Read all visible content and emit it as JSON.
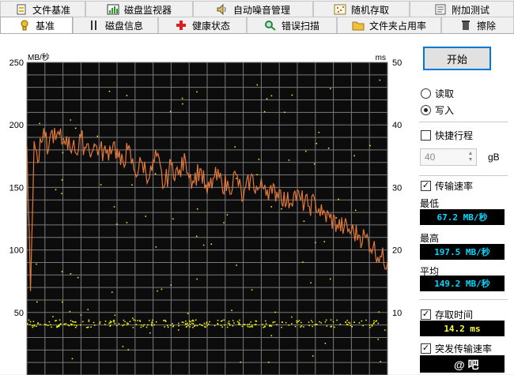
{
  "tabs_top": [
    {
      "label": "文件基准",
      "icon": "file-benchmark-icon"
    },
    {
      "label": "磁盘监视器",
      "icon": "disk-monitor-icon"
    },
    {
      "label": "自动噪音管理",
      "icon": "speaker-icon"
    },
    {
      "label": "随机存取",
      "icon": "random-access-icon"
    },
    {
      "label": "附加测试",
      "icon": "extra-tests-icon"
    }
  ],
  "tabs_bottom": [
    {
      "label": "基准",
      "icon": "benchmark-icon",
      "active": true
    },
    {
      "label": "磁盘信息",
      "icon": "disk-info-icon"
    },
    {
      "label": "健康状态",
      "icon": "health-cross-icon"
    },
    {
      "label": "错误扫描",
      "icon": "magnifier-icon"
    },
    {
      "label": "文件夹占用率",
      "icon": "folder-icon"
    },
    {
      "label": "擦除",
      "icon": "trash-icon"
    }
  ],
  "chart": {
    "left_unit": "MB/秒",
    "right_unit": "ms",
    "left_ticks": [
      "250",
      "200",
      "150",
      "100",
      "50"
    ],
    "right_ticks": [
      "50",
      "40",
      "30",
      "20",
      "10"
    ],
    "colors": {
      "background": "#0c0c0c",
      "grid": "#7a7a7a",
      "transfer": "#e0783a",
      "access": "#ffff00"
    }
  },
  "chart_data": {
    "type": "line",
    "title": "",
    "xlabel": "",
    "ylabel": "MB/秒",
    "y2label": "ms",
    "ylim": [
      0,
      250
    ],
    "y2lim": [
      0,
      50
    ],
    "grid": true,
    "x_range": [
      0,
      100
    ],
    "series": [
      {
        "name": "传输速率",
        "x": [
          0,
          1,
          2,
          3,
          4,
          5,
          6,
          7,
          8,
          9,
          10,
          11,
          12,
          13,
          14,
          15,
          16,
          17,
          18,
          19,
          20,
          22,
          24,
          26,
          28,
          30,
          32,
          34,
          36,
          38,
          40,
          42,
          44,
          46,
          48,
          50,
          52,
          54,
          56,
          58,
          60,
          62,
          64,
          66,
          68,
          70,
          72,
          74,
          76,
          78,
          80,
          82,
          84,
          86,
          88,
          90,
          92,
          94,
          96,
          98,
          100
        ],
        "y": [
          183,
          67,
          187,
          170,
          186,
          190,
          180,
          196,
          188,
          192,
          185,
          191,
          180,
          188,
          176,
          190,
          182,
          185,
          178,
          184,
          180,
          177,
          186,
          168,
          180,
          162,
          170,
          158,
          175,
          150,
          168,
          160,
          172,
          155,
          165,
          145,
          158,
          155,
          150,
          160,
          140,
          158,
          148,
          152,
          145,
          148,
          137,
          145,
          140,
          135,
          138,
          128,
          126,
          120,
          118,
          115,
          112,
          110,
          102,
          95,
          90
        ]
      },
      {
        "name": "存取时间",
        "points": "scatter",
        "typical_ms": 8.3,
        "y_unit": "ms"
      }
    ]
  },
  "controls": {
    "start_label": "开始",
    "read_label": "读取",
    "write_label": "写入",
    "mode_selected": "write",
    "quick_label": "快捷行程",
    "quick_checked": false,
    "quick_value": "40",
    "quick_unit": "gB",
    "transfer_label": "传输速率",
    "transfer_checked": true,
    "min_label": "最低",
    "min_value": "67.2 MB/秒",
    "max_label": "最高",
    "max_value": "197.5 MB/秒",
    "avg_label": "平均",
    "avg_value": "149.2 MB/秒",
    "access_label": "存取时间",
    "access_checked": true,
    "access_value": "14.2 ms",
    "burst_label": "突发传输速率",
    "burst_checked": true
  },
  "watermark": "@ 吧"
}
